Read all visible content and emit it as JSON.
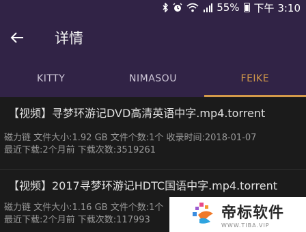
{
  "status_bar": {
    "battery": "55%",
    "time": "下午 3:10",
    "icons": [
      "bluetooth-icon",
      "alarm-icon",
      "wifi-icon",
      "signal-icon",
      "battery-icon"
    ]
  },
  "toolbar": {
    "back_icon": "arrow-left-icon",
    "title": "详情"
  },
  "tabs": [
    {
      "label": "KITTY",
      "active": false
    },
    {
      "label": "NIMASOU",
      "active": false
    },
    {
      "label": "FEIKE",
      "active": true
    }
  ],
  "results": [
    {
      "title": "【视频】寻梦环游记DVD高清英语中字.mp4.torrent",
      "meta1": "磁力链 文件大小:1.92 GB 文件个数:1个 收录时间:2018-01-07",
      "meta2": "最近下载:2个月前 下载次数:3519261"
    },
    {
      "title": "【视频】2017寻梦环游记HDTC国语中字.mp4.torrent",
      "meta1": "磁力链 文件大小:1.16 GB 文件个数:1个",
      "meta2": "最近下载:2个月前 下载次数:117993"
    }
  ],
  "watermark": {
    "name": "帝标软件",
    "url": "WWW.TIBA.VIP"
  },
  "colors": {
    "primary": "#312346",
    "accent": "#d49a4a",
    "background": "#1b1b1b"
  }
}
